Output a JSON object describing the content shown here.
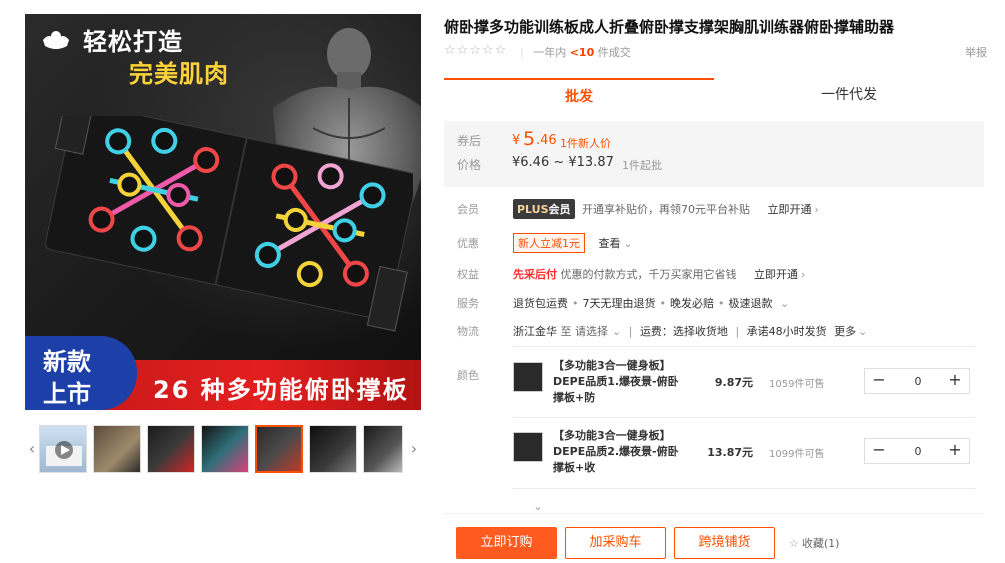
{
  "gallery": {
    "image_headline_1": "轻松打造",
    "image_headline_2": "完美肌肉",
    "badge_line1": "新款",
    "badge_line2": "上市",
    "banner_text": "26 种多功能俯卧撑板"
  },
  "product": {
    "title": "俯卧撑多功能训练板成人折叠俯卧撑支撑架胸肌训练器俯卧撑辅助器",
    "rating_stars": "☆☆☆☆☆",
    "sales_prefix": "一年内",
    "sales_count": "<10",
    "sales_suffix": "件成交",
    "report": "举报"
  },
  "tabs": {
    "wholesale": "批发",
    "dropship": "一件代发"
  },
  "price": {
    "coupon_label": "券后",
    "coupon_currency": "¥",
    "coupon_int": "5",
    "coupon_dec": ".46",
    "new_user_note": "1件新人价",
    "price_label": "价格",
    "range": "¥6.46 ~ ¥13.87",
    "min_order": "1件起批"
  },
  "member": {
    "label": "会员",
    "badge_plus": "PLUS",
    "badge_word": "会员",
    "text": "开通享补贴价，再领70元平台补贴",
    "cta": "立即开通"
  },
  "discount": {
    "label": "优惠",
    "coupon": "新人立减1元",
    "more": "查看"
  },
  "rights": {
    "label": "权益",
    "highlight": "先采后付",
    "text": "优惠的付款方式，千万买家用它省钱",
    "cta": "立即开通"
  },
  "service": {
    "label": "服务",
    "items": [
      "退货包运费",
      "7天无理由退货",
      "晚发必赔",
      "极速退款"
    ]
  },
  "logistics": {
    "label": "物流",
    "origin": "浙江金华",
    "to": "至",
    "dest_placeholder": "请选择",
    "freight": "运费：选择收货地",
    "promise": "承诺48小时发货",
    "more": "更多"
  },
  "sku": {
    "color_label": "颜色",
    "items": [
      {
        "name": "【多功能3合一健身板】DEPE品质1.爆夜景-俯卧撑板+防",
        "price": "9.87元",
        "stock": "1059件可售",
        "qty": "0"
      },
      {
        "name": "【多功能3合一健身板】DEPE品质2.爆夜景-俯卧撑板+收",
        "price": "13.87元",
        "stock": "1099件可售",
        "qty": "0"
      }
    ]
  },
  "actions": {
    "order": "立即订购",
    "cart": "加采购车",
    "cross": "跨境铺货",
    "favorite": "收藏(1)"
  },
  "colors": {
    "accent": "#ff5000",
    "banner_red": "#e31f1f",
    "badge_blue": "#1d3fa8"
  }
}
